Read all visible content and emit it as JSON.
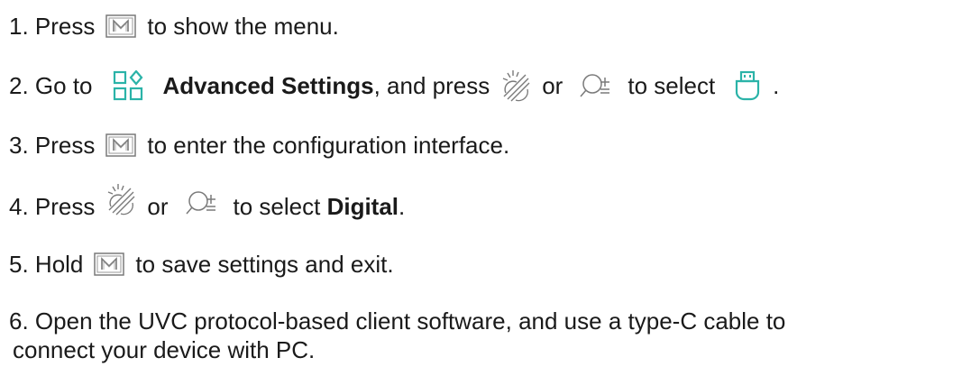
{
  "steps": [
    {
      "number": "1.",
      "text_a": "Press",
      "text_b": "to show the menu.",
      "icons": [
        "m-key-icon"
      ]
    },
    {
      "number": "2.",
      "text_a": "Go to",
      "bold": "Advanced Settings",
      "text_b": ", and press",
      "text_c": "or",
      "text_d": "to select",
      "text_e": ".",
      "icons": [
        "advanced-settings-icon",
        "brightness-icon",
        "zoom-icon",
        "usb-icon"
      ]
    },
    {
      "number": "3.",
      "text_a": "Press",
      "text_b": "to enter the configuration interface.",
      "icons": [
        "m-key-icon"
      ]
    },
    {
      "number": "4.",
      "text_a": "Press",
      "text_b": "or",
      "text_c": "to select",
      "bold": "Digital",
      "text_d": ".",
      "icons": [
        "brightness-icon",
        "zoom-icon"
      ]
    },
    {
      "number": "5.",
      "text_a": "Hold",
      "text_b": "to save settings and exit.",
      "icons": [
        "m-key-icon"
      ]
    },
    {
      "number": "6.",
      "text_a": "Open the UVC protocol-based client software, and use a type-C cable to",
      "text_b": "connect your device with PC."
    }
  ],
  "colors": {
    "text": "#1a1a1a",
    "accent": "#2bb3a8",
    "icon_gray": "#7a7a7a"
  }
}
